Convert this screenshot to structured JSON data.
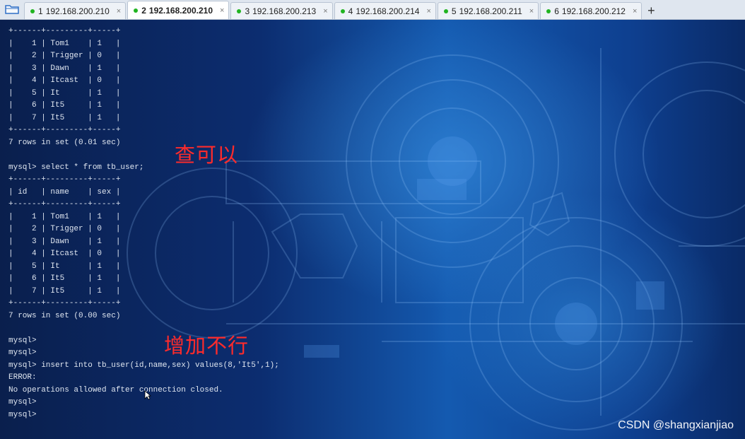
{
  "tabs": [
    {
      "number": "1",
      "label": "192.168.200.210",
      "close": "×",
      "active": false
    },
    {
      "number": "2",
      "label": "192.168.200.210",
      "close": "×",
      "active": true
    },
    {
      "number": "3",
      "label": "192.168.200.213",
      "close": "×",
      "active": false
    },
    {
      "number": "4",
      "label": "192.168.200.214",
      "close": "×",
      "active": false
    },
    {
      "number": "5",
      "label": "192.168.200.211",
      "close": "×",
      "active": false
    },
    {
      "number": "6",
      "label": "192.168.200.212",
      "close": "×",
      "active": false
    }
  ],
  "new_tab": "+",
  "terminal": {
    "lines": [
      "+------+---------+-----+",
      "|    1 | Tom1    | 1   |",
      "|    2 | Trigger | 0   |",
      "|    3 | Dawn    | 1   |",
      "|    4 | Itcast  | 0   |",
      "|    5 | It      | 1   |",
      "|    6 | It5     | 1   |",
      "|    7 | It5     | 1   |",
      "+------+---------+-----+",
      "7 rows in set (0.01 sec)",
      "",
      "mysql> select * from tb_user;",
      "+------+---------+-----+",
      "| id   | name    | sex |",
      "+------+---------+-----+",
      "|    1 | Tom1    | 1   |",
      "|    2 | Trigger | 0   |",
      "|    3 | Dawn    | 1   |",
      "|    4 | Itcast  | 0   |",
      "|    5 | It      | 1   |",
      "|    6 | It5     | 1   |",
      "|    7 | It5     | 1   |",
      "+------+---------+-----+",
      "7 rows in set (0.00 sec)",
      "",
      "mysql>",
      "mysql>",
      "mysql> insert into tb_user(id,name,sex) values(8,'It5',1);",
      "ERROR:",
      "No operations allowed after connection closed.",
      "mysql>",
      "mysql>"
    ]
  },
  "annotations": {
    "query_ok": "查可以",
    "insert_fail": "增加不行"
  },
  "watermark": "CSDN @shangxianjiao",
  "colors": {
    "annotation": "#ff2b2b",
    "terminal_text": "#dfe6f0",
    "status_dot": "#21b421"
  }
}
